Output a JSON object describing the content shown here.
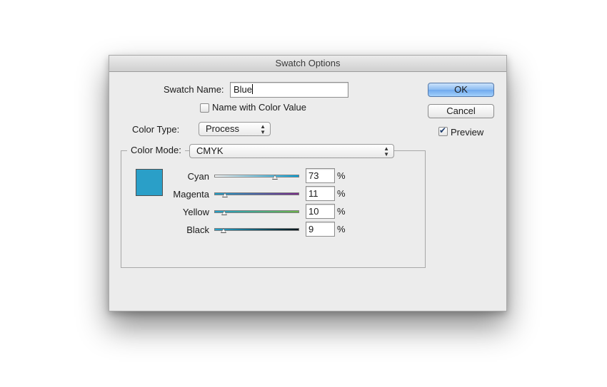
{
  "window": {
    "title": "Swatch Options"
  },
  "swatch_name": {
    "label": "Swatch Name:",
    "value": "Blue"
  },
  "name_with_color_value": {
    "label": "Name with Color Value",
    "checked": false
  },
  "color_type": {
    "label": "Color Type:",
    "value": "Process"
  },
  "color_mode": {
    "label": "Color Mode:",
    "value": "CMYK"
  },
  "swatch_color": "#2a9fc8",
  "sliders": [
    {
      "label": "Cyan",
      "value": "73",
      "percent": 73,
      "unit": "%",
      "gradient": [
        "#ffffff",
        "#00a0d8"
      ]
    },
    {
      "label": "Magenta",
      "value": "11",
      "percent": 11,
      "unit": "%",
      "gradient": [
        "#1e9ec6",
        "#7a2a8a"
      ]
    },
    {
      "label": "Yellow",
      "value": "10",
      "percent": 10,
      "unit": "%",
      "gradient": [
        "#23a0c9",
        "#6cb44a"
      ]
    },
    {
      "label": "Black",
      "value": "9",
      "percent": 9,
      "unit": "%",
      "gradient": [
        "#26a3cc",
        "#04161c"
      ]
    }
  ],
  "buttons": {
    "ok": "OK",
    "cancel": "Cancel"
  },
  "preview": {
    "label": "Preview",
    "checked": true
  }
}
